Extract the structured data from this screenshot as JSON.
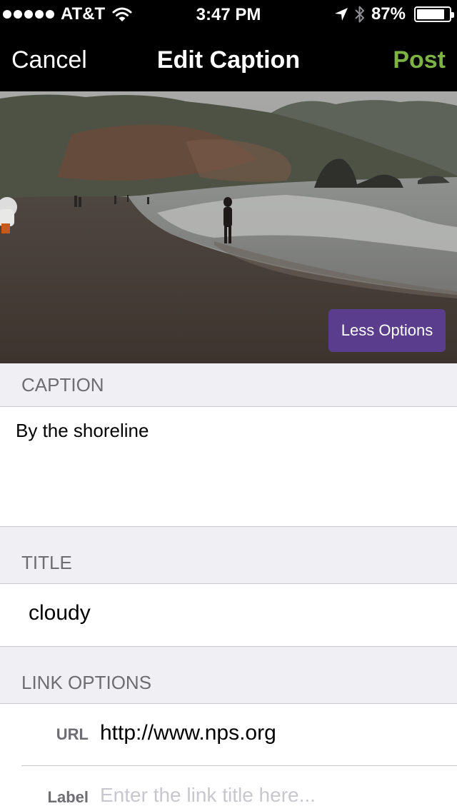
{
  "status_bar": {
    "carrier": "AT&T",
    "time": "3:47 PM",
    "battery_percent": "87%",
    "battery_level": 0.87,
    "icons": [
      "signal-dots",
      "wifi-icon",
      "location-arrow-icon",
      "bluetooth-icon",
      "battery-icon"
    ]
  },
  "nav": {
    "cancel_label": "Cancel",
    "title": "Edit Caption",
    "post_label": "Post",
    "post_color": "#7cb342"
  },
  "photo": {
    "less_options_label": "Less Options",
    "button_color": "#5a3d8c"
  },
  "caption": {
    "header": "CAPTION",
    "value": "By the shoreline"
  },
  "title_section": {
    "header": "TITLE",
    "value": "cloudy"
  },
  "link_options": {
    "header": "LINK OPTIONS",
    "url_label": "URL",
    "url_value": "http://www.nps.org",
    "label_label": "Label",
    "label_placeholder": "Enter the link title here..."
  }
}
